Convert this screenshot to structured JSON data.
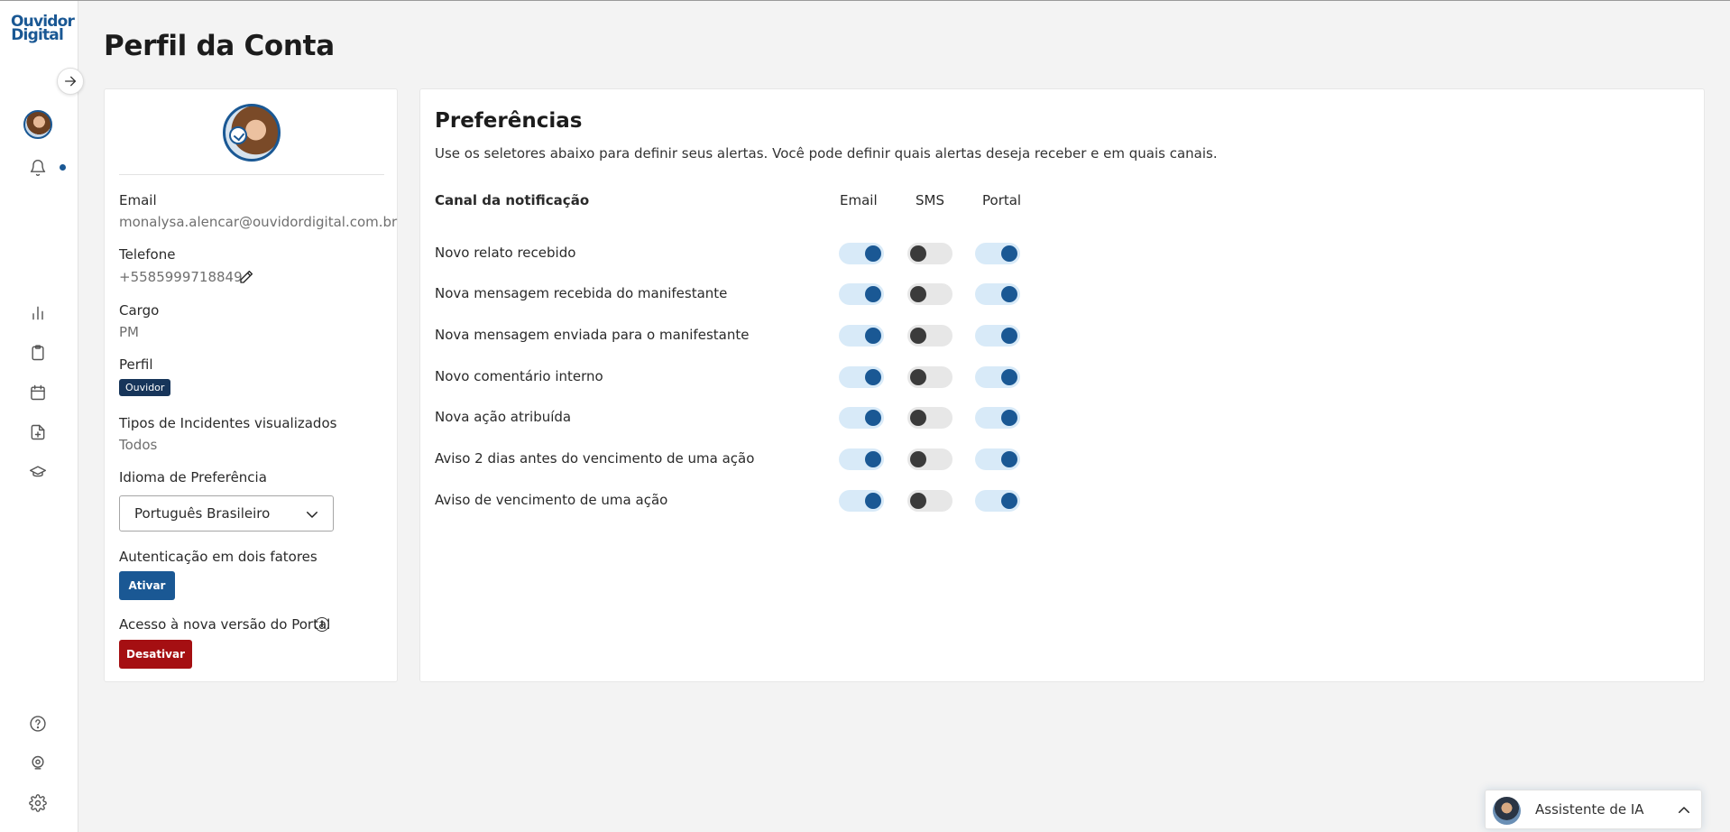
{
  "brand": {
    "line1": "Ouvidor",
    "line2": "Digital"
  },
  "page": {
    "title": "Perfil da Conta"
  },
  "profile": {
    "email_label": "Email",
    "email_value": "monalysa.alencar@ouvidordigital.com.br",
    "phone_label": "Telefone",
    "phone_value": "+5585999718849",
    "role_label": "Cargo",
    "role_value": "PM",
    "profile_label": "Perfil",
    "profile_badge": "Ouvidor",
    "incident_types_label": "Tipos de Incidentes visualizados",
    "incident_types_value": "Todos",
    "language_label": "Idioma de Preferência",
    "language_value": "Português Brasileiro",
    "two_factor_label": "Autenticação em dois fatores",
    "two_factor_button": "Ativar",
    "new_portal_label": "Acesso à nova versão do Portal",
    "new_portal_button": "Desativar"
  },
  "preferences": {
    "title": "Preferências",
    "description": "Use os seletores abaixo para definir seus alertas. Você pode definir quais alertas deseja receber e em quais canais.",
    "columns": {
      "channel": "Canal da notificação",
      "email": "Email",
      "sms": "SMS",
      "portal": "Portal"
    },
    "rows": [
      {
        "label": "Novo relato recebido",
        "email": true,
        "sms": false,
        "portal": true
      },
      {
        "label": "Nova mensagem recebida do manifestante",
        "email": true,
        "sms": false,
        "portal": true
      },
      {
        "label": "Nova mensagem enviada para o manifestante",
        "email": true,
        "sms": false,
        "portal": true
      },
      {
        "label": "Novo comentário interno",
        "email": true,
        "sms": false,
        "portal": true
      },
      {
        "label": "Nova ação atribuída",
        "email": true,
        "sms": false,
        "portal": true
      },
      {
        "label": "Aviso 2 dias antes do vencimento de uma ação",
        "email": true,
        "sms": false,
        "portal": true
      },
      {
        "label": "Aviso de vencimento de uma ação",
        "email": true,
        "sms": false,
        "portal": true
      }
    ]
  },
  "assistant": {
    "label": "Assistente de IA"
  },
  "sidebar": {
    "icons": [
      "arrow-right-icon",
      "bell-icon",
      "bar-chart-icon",
      "clipboard-icon",
      "calendar-icon",
      "file-plus-icon",
      "graduation-cap-icon",
      "help-icon",
      "location-pin-icon",
      "gear-icon"
    ]
  },
  "colors": {
    "primary": "#1a5894",
    "danger": "#a50f12",
    "badge": "#17355a",
    "toggle_on_track": "#d8eaf8",
    "toggle_off_track": "#e7e7e7"
  }
}
